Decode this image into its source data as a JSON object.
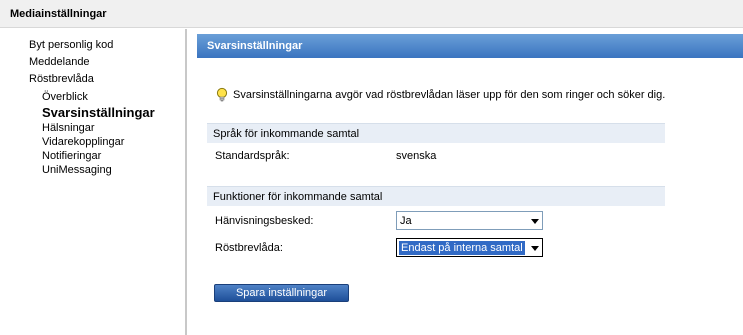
{
  "window": {
    "title": "Mediainställningar"
  },
  "sidebar": {
    "items": [
      {
        "label": "Byt personlig kod"
      },
      {
        "label": "Meddelande"
      },
      {
        "label": "Röstbrevlåda"
      }
    ],
    "subitems": [
      {
        "label": "Överblick"
      },
      {
        "label": "Svarsinställningar",
        "active": true
      },
      {
        "label": "Hälsningar"
      },
      {
        "label": "Vidarekopplingar"
      },
      {
        "label": "Notifieringar"
      },
      {
        "label": "UniMessaging"
      }
    ]
  },
  "panel": {
    "title": "Svarsinställningar",
    "info_icon": "lightbulb-icon",
    "info_text": "Svarsinställningarna avgör vad röstbrevlådan läser upp för den som ringer och söker dig.",
    "section_language": {
      "title": "Språk för inkommande samtal",
      "label": "Standardspråk:",
      "value": "svenska"
    },
    "section_functions": {
      "title": "Funktioner för inkommande samtal",
      "referral_label": "Hänvisningsbesked:",
      "referral_value": "Ja",
      "voicemail_label": "Röstbrevlåda:",
      "voicemail_value": "Endast på interna samtal"
    },
    "save_label": "Spara inställningar"
  },
  "colors": {
    "header_blue": "#3a74c0",
    "section_bg": "#e8eef6",
    "selection_blue": "#316ac5"
  }
}
